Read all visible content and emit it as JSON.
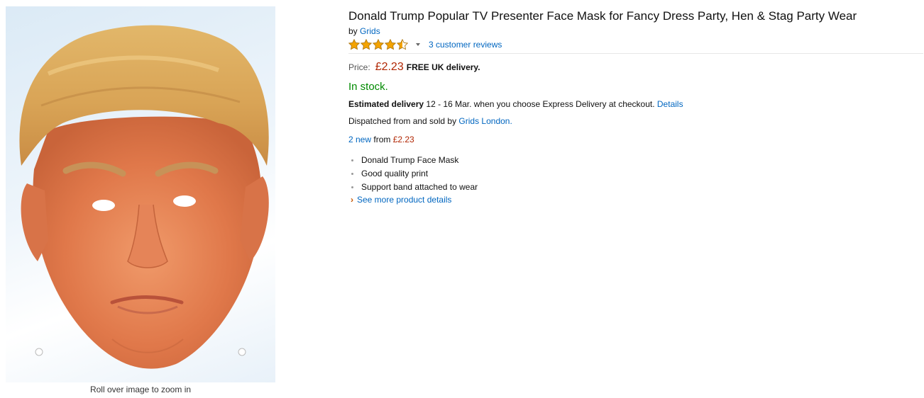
{
  "product": {
    "title": "Donald Trump Popular TV Presenter Face Mask for Fancy Dress Party, Hen & Stag Party Wear",
    "by_prefix": "by",
    "brand": "Grids",
    "rating": 4.5,
    "rating_max": 5,
    "reviews_link": "3 customer reviews",
    "price_label": "Price:",
    "price": "£2.23",
    "free_delivery": "FREE UK delivery.",
    "stock": "In stock.",
    "delivery_label": "Estimated delivery",
    "delivery_text": " 12 - 16 Mar. when you choose Express Delivery at checkout. ",
    "delivery_details_link": "Details",
    "dispatch_text": "Dispatched from and sold by ",
    "seller": "Grids London.",
    "new_count_link": "2 new",
    "new_from_text": " from ",
    "new_from_price": "£2.23",
    "bullets": [
      "Donald Trump Face Mask",
      "Good quality print",
      "Support band attached to wear"
    ],
    "see_more": "See more product details"
  },
  "image": {
    "caption": "Roll over image to zoom in",
    "subject": "face-mask-photo"
  },
  "colors": {
    "link": "#0066c0",
    "price": "#b12704",
    "in_stock": "#008a00",
    "star": "#f4a300",
    "chevron": "#c45500"
  },
  "icons": {
    "stars": "star-rating-icon",
    "dropdown": "caret-down-icon",
    "bullet": "bullet-icon",
    "see_more": "chevron-right-icon"
  }
}
